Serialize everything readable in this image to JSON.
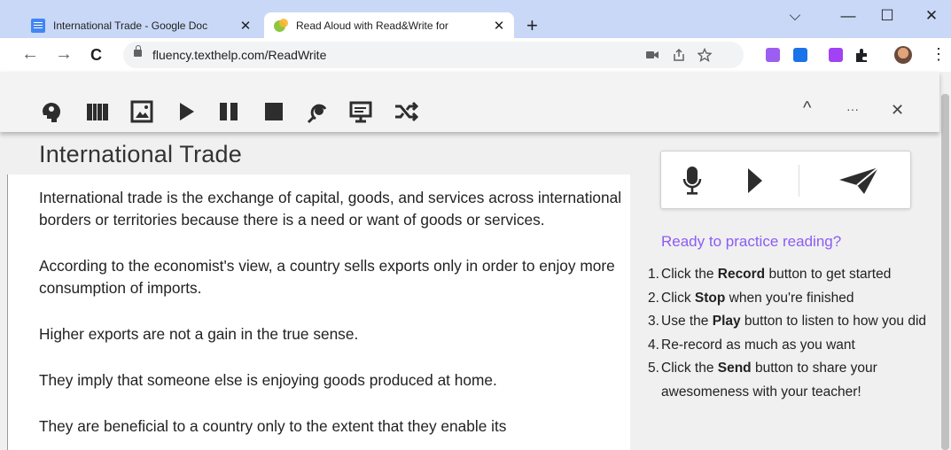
{
  "browser": {
    "tabs": [
      {
        "title": "International Trade - Google Doc",
        "close": "✕",
        "icon": "google-docs-icon"
      },
      {
        "title": "Read Aloud with Read&Write for",
        "close": "✕",
        "icon": "readwrite-icon"
      }
    ],
    "new_tab": "+",
    "window": {
      "dropdown": "⌵",
      "minimize": "—",
      "maximize": "☐",
      "close": "✕"
    },
    "nav": {
      "back": "←",
      "forward": "→",
      "reload": "C"
    },
    "url": "fluency.texthelp.com/ReadWrite",
    "omnibox_icons": [
      "camera-icon",
      "share-icon",
      "star-icon"
    ],
    "menu": "⋮"
  },
  "readwrite_toolbar": {
    "tools": [
      "speak-icon",
      "dictionary-icon",
      "picture-dictionary-icon",
      "play-icon",
      "pause-icon",
      "stop-icon",
      "voice-note-icon",
      "screenshot-reader-icon",
      "rewordify-icon"
    ],
    "collapse": "^",
    "more": "···",
    "close": "✕",
    "colors": {
      "icons": "#2d2d2d",
      "bar": "#f3f3f3"
    }
  },
  "document": {
    "title": "International Trade",
    "paragraphs": [
      "International trade is the exchange of capital, goods, and services across international borders or territories because there is a need or want of goods or services.",
      "According to the economist's view, a country sells exports only in order to enjoy more consumption of imports.",
      "Higher exports are not a gain in the true sense.",
      "They imply that someone else is enjoying goods produced at home.",
      "They are beneficial to a country only to the extent that they enable its"
    ]
  },
  "practice": {
    "buttons": [
      "microphone-icon",
      "play-icon",
      "send-icon"
    ],
    "heading": "Ready to practice reading?",
    "heading_color": "#8b5cf6",
    "steps": [
      {
        "num": "1.",
        "before": "Click the ",
        "bold": "Record",
        "after": " button to get started"
      },
      {
        "num": "2.",
        "before": "Click ",
        "bold": "Stop",
        "after": " when you're finished"
      },
      {
        "num": "3.",
        "before": "Use the ",
        "bold": "Play",
        "after": " button to listen to how you did"
      },
      {
        "num": "4.",
        "before": "Re-record as much as you want",
        "bold": "",
        "after": ""
      },
      {
        "num": "5.",
        "before": "Click the ",
        "bold": "Send",
        "after": " button to share your awesomeness with your teacher!"
      }
    ]
  }
}
